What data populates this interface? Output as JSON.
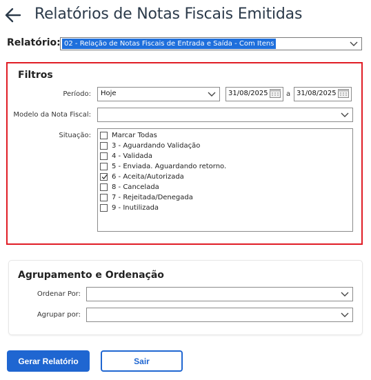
{
  "header": {
    "title": "Relatórios de Notas Fiscais Emitidas"
  },
  "report": {
    "label": "Relatório:",
    "selected": "02 - Relação de Notas Fiscais de Entrada e Saída - Com Itens"
  },
  "filters": {
    "title": "Filtros",
    "period": {
      "label": "Período:",
      "value": "Hoje",
      "date_from": "31/08/2025",
      "date_sep": "a",
      "date_to": "31/08/2025"
    },
    "model": {
      "label": "Modelo da Nota Fiscal:",
      "value": ""
    },
    "situation": {
      "label": "Situação:",
      "options": [
        {
          "label": "Marcar Todas",
          "checked": false
        },
        {
          "label": "3 - Aguardando Validação",
          "checked": false
        },
        {
          "label": "4 - Validada",
          "checked": false
        },
        {
          "label": "5 - Enviada. Aguardando retorno.",
          "checked": false
        },
        {
          "label": "6 - Aceita/Autorizada",
          "checked": true
        },
        {
          "label": "8 - Cancelada",
          "checked": false
        },
        {
          "label": "7 - Rejeitada/Denegada",
          "checked": false
        },
        {
          "label": "9 - Inutilizada",
          "checked": false
        }
      ]
    }
  },
  "grouping": {
    "title": "Agrupamento e Ordenação",
    "order_label": "Ordenar Por:",
    "order_value": "",
    "group_label": "Agrupar por:",
    "group_value": ""
  },
  "actions": {
    "generate_label": "Gerar Relatório",
    "exit_label": "Sair"
  },
  "colors": {
    "primary": "#1f66d1",
    "highlight_border": "#e01b24",
    "selection": "#1e6fdc"
  }
}
